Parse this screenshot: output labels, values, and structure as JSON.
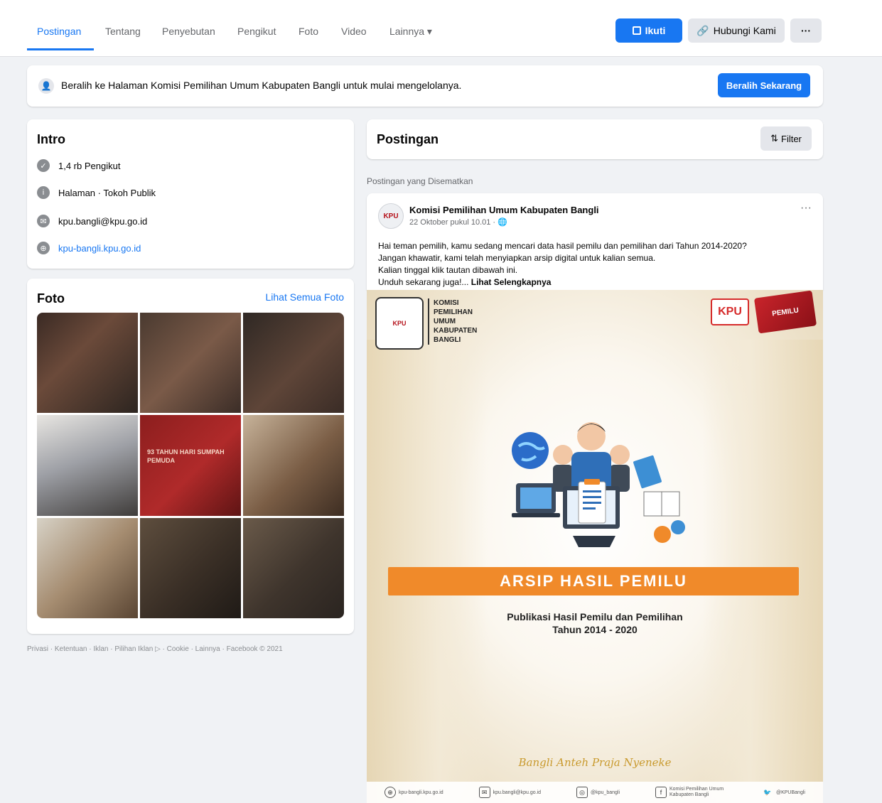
{
  "nav": {
    "tabs": [
      "Postingan",
      "Tentang",
      "Penyebutan",
      "Pengikut",
      "Foto",
      "Video",
      "Lainnya ▾"
    ],
    "active_tab": "Postingan",
    "edit_button": "Ikuti",
    "contact_button": "Hubungi Kami",
    "more_button": "···"
  },
  "banner": {
    "text": "Beralih ke Halaman Komisi Pemilihan Umum Kabupaten Bangli untuk mulai mengelolanya.",
    "button": "Beralih Sekarang"
  },
  "intro": {
    "title": "Intro",
    "followers": "1,4 rb Pengikut",
    "category": "Halaman · Tokoh Publik",
    "email": "kpu.bangli@kpu.go.id",
    "website": "kpu-bangli.kpu.go.id"
  },
  "photos": {
    "title": "Foto",
    "see_all": "Lihat Semua Foto",
    "tile5_caption": "93 TAHUN HARI SUMPAH PEMUDA"
  },
  "footer": "Privasi · Ketentuan · Iklan · Pilihan Iklan ▷ · Cookie · Lainnya · Facebook © 2021",
  "posts": {
    "title": "Postingan",
    "filter": "Filter",
    "pinned_label": "Postingan yang Disematkan",
    "author": "Komisi Pemilihan Umum Kabupaten Bangli",
    "time": "22 Oktober pukul 10.01 · 🌐",
    "body": [
      "Hai teman pemilih, kamu sedang mencari data hasil pemilu dan pemilihan dari Tahun 2014-2020?",
      "Jangan khawatir, kami telah menyiapkan arsip digital untuk kalian semua.",
      "Kalian tinggal klik tautan dibawah ini.",
      "Unduh sekarang juga!..."
    ],
    "see_more": "Lihat Selengkapnya"
  },
  "poster": {
    "org_lines": [
      "KOMISI",
      "PEMILIHAN",
      "UMUM",
      "KABUPATEN",
      "BANGLI"
    ],
    "kpu_badge": "KPU",
    "pemilu_badge": "PEMILU",
    "headline": "ARSIP HASIL PEMILU",
    "sub1": "Publikasi Hasil Pemilu dan Pemilihan",
    "sub2": "Tahun 2014 - 2020",
    "tagline": "Bangli Anteh Praja Nyeneke",
    "contacts": [
      "kpu-bangli.kpu.go.id",
      "kpu.bangli@kpu.go.id",
      "@kpu_bangli",
      "Komisi Pemilihan Umum Kabupaten Bangli",
      "@KPUBangli"
    ]
  },
  "colors": {
    "brand_blue": "#1877f2",
    "orange_banner": "#f08a2a",
    "page_bg": "#f0f2f5"
  }
}
